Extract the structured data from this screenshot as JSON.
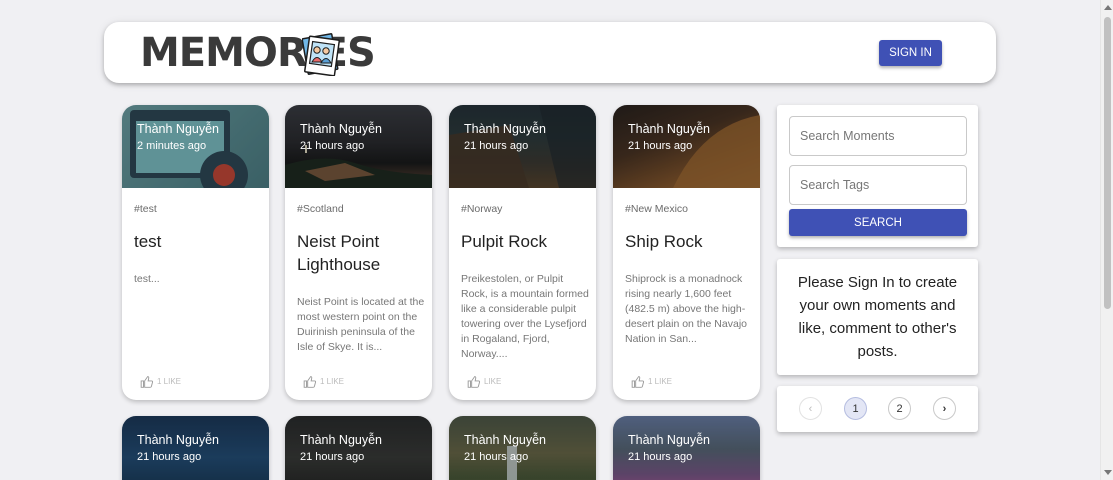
{
  "header": {
    "brand": "MEMORIES",
    "signin_label": "SIGN IN"
  },
  "posts": [
    {
      "creator": "Thành Nguyễn",
      "time": "2 minutes ago",
      "tags": "#test",
      "title": "test",
      "excerpt": "test...",
      "likes": "1 LIKE"
    },
    {
      "creator": "Thành Nguyễn",
      "time": "21 hours ago",
      "tags": "#Scotland",
      "title": "Neist Point Lighthouse",
      "excerpt": "Neist Point is located at the most western point on the Duirinish peninsula of the Isle of Skye. It is...",
      "likes": "1 LIKE"
    },
    {
      "creator": "Thành Nguyễn",
      "time": "21 hours ago",
      "tags": "#Norway",
      "title": "Pulpit Rock",
      "excerpt": "Preikestolen, or Pulpit Rock, is a mountain formed like a considerable pulpit towering over the Lysefjord in Rogaland, Fjord, Norway....",
      "likes": "LIKE"
    },
    {
      "creator": "Thành Nguyễn",
      "time": "21 hours ago",
      "tags": "#New Mexico",
      "title": "Ship Rock",
      "excerpt": "Shiprock is a monadnock rising nearly 1,600 feet (482.5 m) above the high-desert plain on the Navajo Nation in San...",
      "likes": "1 LIKE"
    },
    {
      "creator": "Thành Nguyễn",
      "time": "21 hours ago"
    },
    {
      "creator": "Thành Nguyễn",
      "time": "21 hours ago"
    },
    {
      "creator": "Thành Nguyễn",
      "time": "21 hours ago"
    },
    {
      "creator": "Thành Nguyễn",
      "time": "21 hours ago"
    }
  ],
  "search": {
    "moments_placeholder": "Search Moments",
    "tags_placeholder": "Search Tags",
    "button_label": "SEARCH"
  },
  "info": {
    "message": "Please Sign In to create your own moments and like, comment to other's posts."
  },
  "pagination": {
    "prev": "‹",
    "pages": [
      "1",
      "2"
    ],
    "next": "›",
    "current": "1"
  },
  "colors": {
    "primary": "#3f51b5",
    "background": "#f0f0f3"
  },
  "icons": {
    "like": "thumb-up-icon",
    "logo": "memories-photo-icon"
  }
}
